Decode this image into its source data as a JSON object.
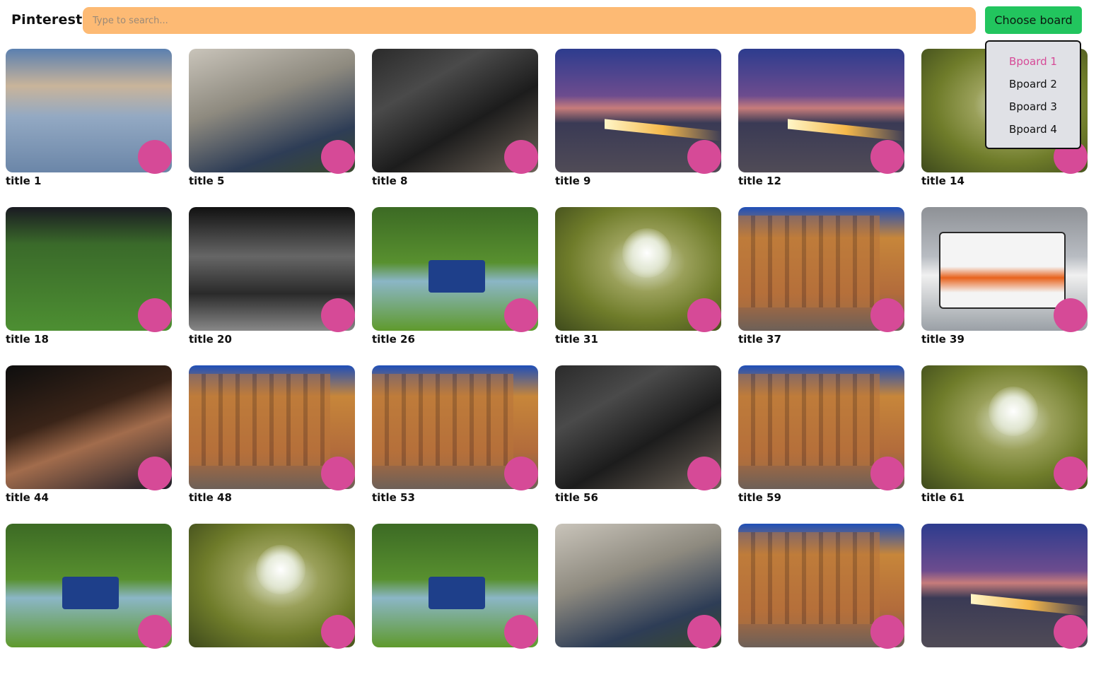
{
  "header": {
    "logo": "Pinterest",
    "search_placeholder": "Type to search...",
    "choose_board_label": "Choose board"
  },
  "dropdown": {
    "items": [
      {
        "label": "Bpoard 1",
        "active": true
      },
      {
        "label": "Bpoard 2",
        "active": false
      },
      {
        "label": "Bpoard 3",
        "active": false
      },
      {
        "label": "Bpoard 4",
        "active": false
      }
    ]
  },
  "pins": [
    {
      "title": "title 1",
      "image": "lake-sky"
    },
    {
      "title": "title 5",
      "image": "soldier-children"
    },
    {
      "title": "title 8",
      "image": "metal-concert"
    },
    {
      "title": "title 9",
      "image": "bridge-light-trails"
    },
    {
      "title": "title 12",
      "image": "bridge-light-trails"
    },
    {
      "title": "title 14",
      "image": "dandelion"
    },
    {
      "title": "title 18",
      "image": "soccer-player"
    },
    {
      "title": "title 20",
      "image": "night-street-bw"
    },
    {
      "title": "title 26",
      "image": "blue-truck"
    },
    {
      "title": "title 31",
      "image": "dandelion"
    },
    {
      "title": "title 37",
      "image": "palace-square"
    },
    {
      "title": "title 39",
      "image": "double-decker-bus"
    },
    {
      "title": "title 44",
      "image": "two-women"
    },
    {
      "title": "title 48",
      "image": "palace-square"
    },
    {
      "title": "title 53",
      "image": "palace-square"
    },
    {
      "title": "title 56",
      "image": "metal-concert"
    },
    {
      "title": "title 59",
      "image": "palace-square"
    },
    {
      "title": "title 61",
      "image": "dandelion"
    },
    {
      "title": "",
      "image": "blue-truck"
    },
    {
      "title": "",
      "image": "dandelion"
    },
    {
      "title": "",
      "image": "blue-truck"
    },
    {
      "title": "",
      "image": "soldier-children"
    },
    {
      "title": "",
      "image": "palace-square"
    },
    {
      "title": "",
      "image": "bridge-light-trails"
    }
  ],
  "colors": {
    "search_bg": "#fdba74",
    "button_bg": "#22c55e",
    "save_dot": "#d64a97",
    "dropdown_active": "#d64a97"
  }
}
